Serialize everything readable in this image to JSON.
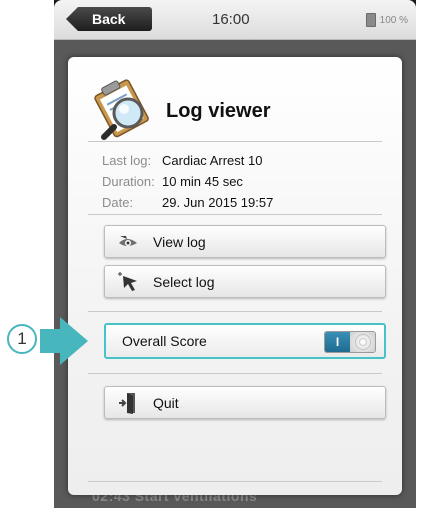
{
  "status_bar": {
    "back_label": "Back",
    "time": "16:00",
    "battery_text": "100 %"
  },
  "background": {
    "partial_text": "02:43 Start ventilations"
  },
  "dialog": {
    "title": "Log viewer",
    "icon": "clipboard-magnifier-icon",
    "info": [
      {
        "label": "Last log:",
        "value": "Cardiac Arrest 10"
      },
      {
        "label": "Duration:",
        "value": "10 min 45 sec"
      },
      {
        "label": "Date:",
        "value": "29. Jun 2015 19:57"
      }
    ],
    "buttons": {
      "view_log": "View log",
      "select_log": "Select log",
      "quit": "Quit"
    },
    "toggle": {
      "label": "Overall Score",
      "on_text": "I",
      "state": "on",
      "highlight_color": "#47c3c8"
    }
  },
  "callout": {
    "number": "1",
    "color": "#47b6bd"
  }
}
